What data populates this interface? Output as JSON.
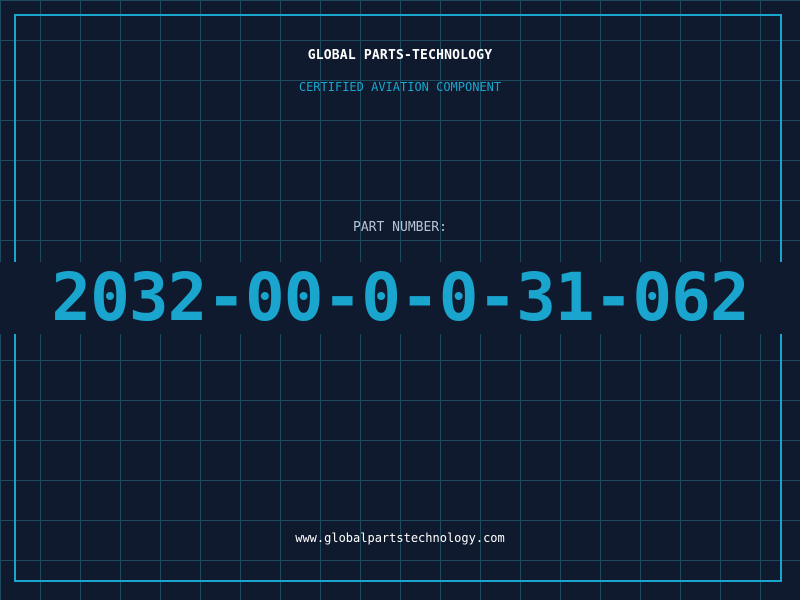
{
  "header": {
    "company": "GLOBAL PARTS-TECHNOLOGY",
    "tagline": "CERTIFIED AVIATION COMPONENT"
  },
  "part": {
    "label": "PART NUMBER:",
    "number": "2032-00-0-0-31-062"
  },
  "footer": {
    "url": "www.globalpartstechnology.com"
  },
  "colors": {
    "background": "#0f1a2e",
    "grid": "#1f4a5e",
    "accent": "#1aa5cf",
    "text": "#ffffff",
    "muted": "#b7c3d6"
  }
}
